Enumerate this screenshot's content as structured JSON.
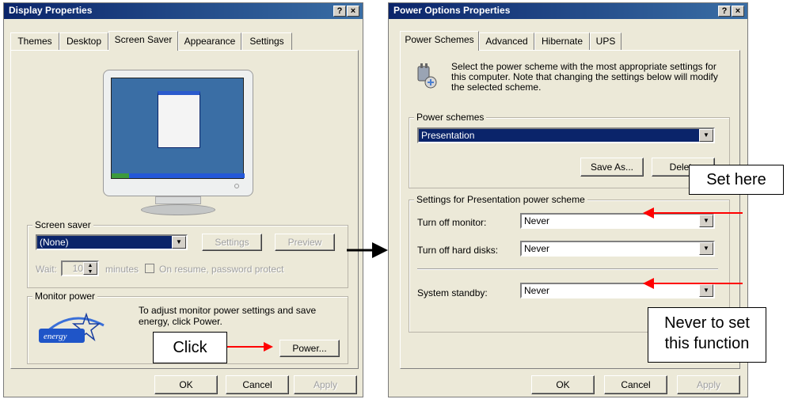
{
  "left_window": {
    "title": "Display Properties",
    "title_buttons": [
      "?",
      "×"
    ],
    "tabs": [
      "Themes",
      "Desktop",
      "Screen Saver",
      "Appearance",
      "Settings"
    ],
    "screen_saver": {
      "legend": "Screen saver",
      "value": "(None)",
      "settings_label": "Settings",
      "preview_label": "Preview",
      "wait_label": "Wait:",
      "wait_value": "10",
      "minutes_label": "minutes",
      "resume_label": "On resume, password protect"
    },
    "monitor_power": {
      "legend": "Monitor power",
      "description": "To adjust monitor power settings and save energy, click Power.",
      "power_label": "Power..."
    },
    "buttons": {
      "ok": "OK",
      "cancel": "Cancel",
      "apply": "Apply"
    }
  },
  "right_window": {
    "title": "Power Options Properties",
    "title_buttons": [
      "?",
      "×"
    ],
    "tabs": [
      "Power Schemes",
      "Advanced",
      "Hibernate",
      "UPS"
    ],
    "intro": "Select the power scheme with the most appropriate settings for this computer. Note that changing the settings below will modify the selected scheme.",
    "schemes": {
      "legend": "Power schemes",
      "value": "Presentation",
      "save_as_label": "Save As...",
      "delete_label": "Delete"
    },
    "settings": {
      "legend": "Settings for Presentation power scheme",
      "monitor_label": "Turn off monitor:",
      "monitor_value": "Never",
      "disks_label": "Turn off hard disks:",
      "disks_value": "Never",
      "standby_label": "System standby:",
      "standby_value": "Never"
    },
    "buttons": {
      "ok": "OK",
      "cancel": "Cancel",
      "apply": "Apply"
    }
  },
  "annotations": {
    "click": "Click",
    "set_here": "Set here",
    "never_line1": "Never to set",
    "never_line2": "this function"
  },
  "colors": {
    "arrow": "#ff0000",
    "titlebar": "#0a246a",
    "dialog": "#ece9d8"
  }
}
